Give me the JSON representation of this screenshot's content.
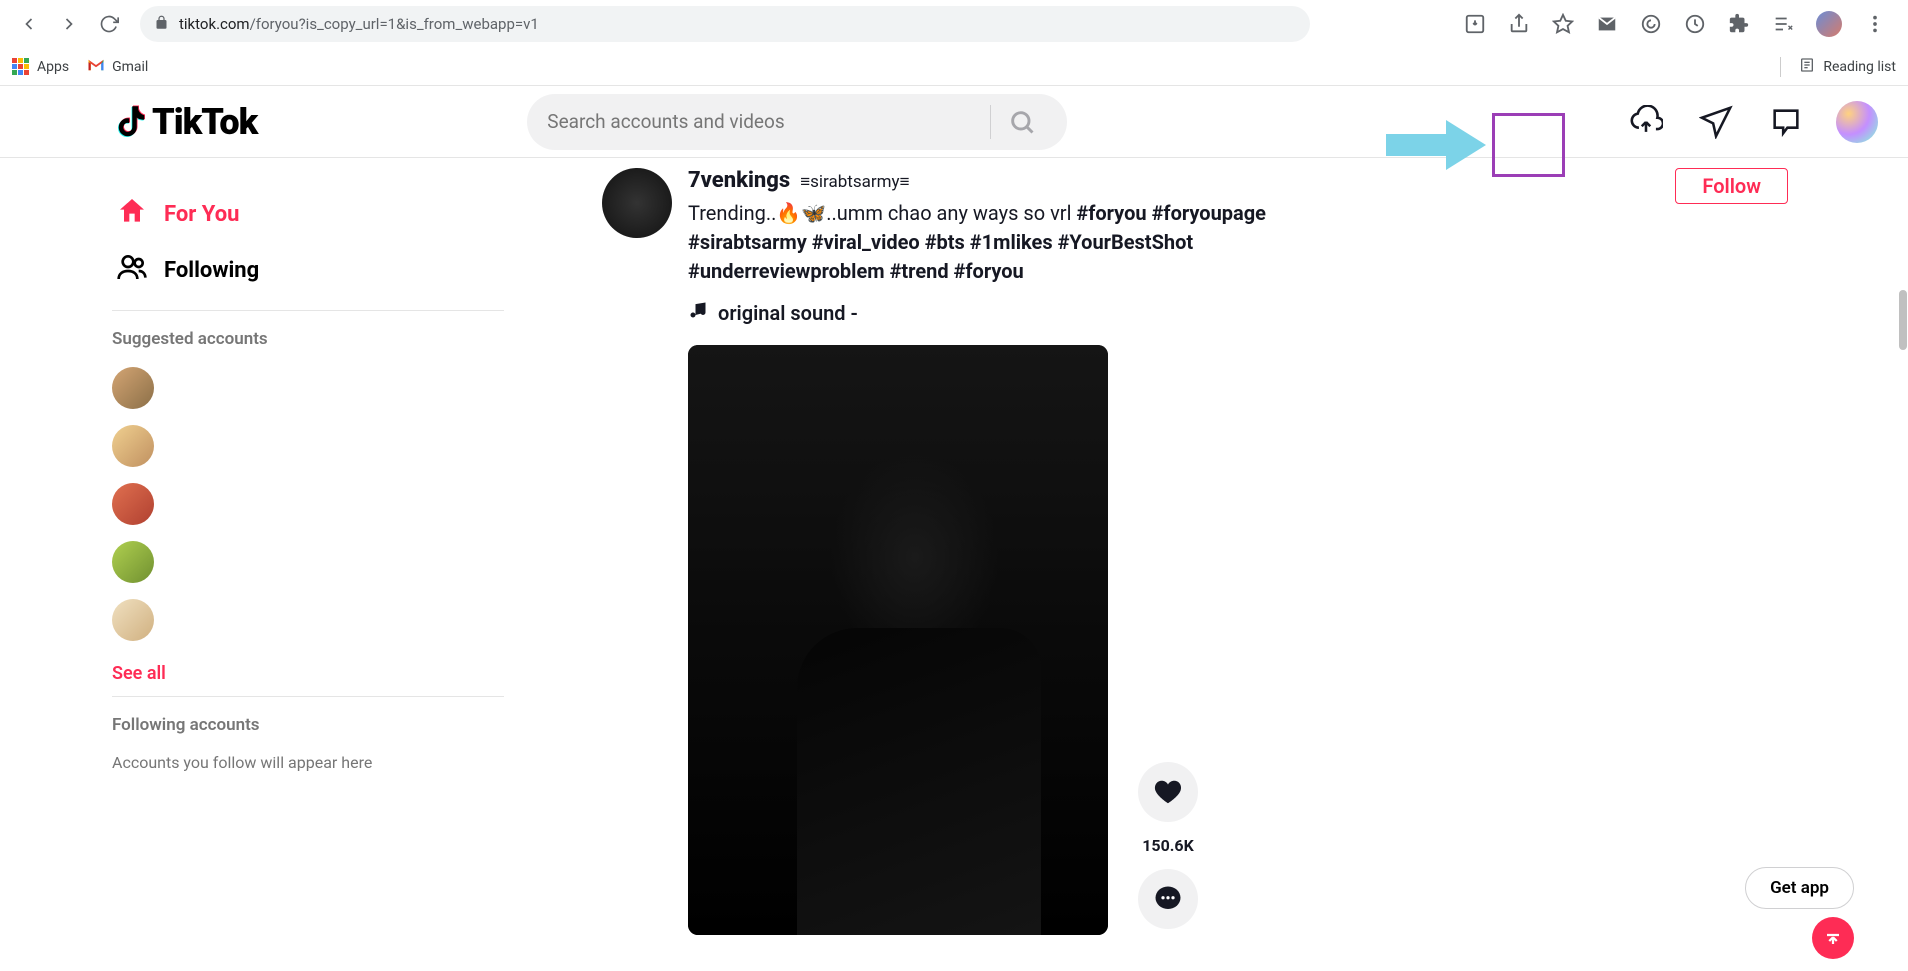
{
  "browser": {
    "url_host": "tiktok.com",
    "url_path": "/foryou?is_copy_url=1&is_from_webapp=v1"
  },
  "bookmarks": {
    "apps": "Apps",
    "gmail": "Gmail",
    "reading_list": "Reading list"
  },
  "header": {
    "logo_text": "TikTok",
    "search_placeholder": "Search accounts and videos"
  },
  "sidebar": {
    "for_you": "For You",
    "following": "Following",
    "suggested_title": "Suggested accounts",
    "see_all": "See all",
    "following_title": "Following accounts",
    "following_empty": "Accounts you follow will appear here"
  },
  "post": {
    "username": "7venkings",
    "handle": "≡sirabtsarmy≡",
    "caption_plain": "Trending..🔥🦋..umm chao any ways so vrl ",
    "hashtags": "#foryou #foryoupage #sirabtsarmy #viral_video #bts #1mlikes #YourBestShot #underreviewproblem #trend #foryou",
    "sound": "original sound -",
    "follow": "Follow",
    "likes": "150.6K"
  },
  "floating": {
    "get_app": "Get app"
  }
}
